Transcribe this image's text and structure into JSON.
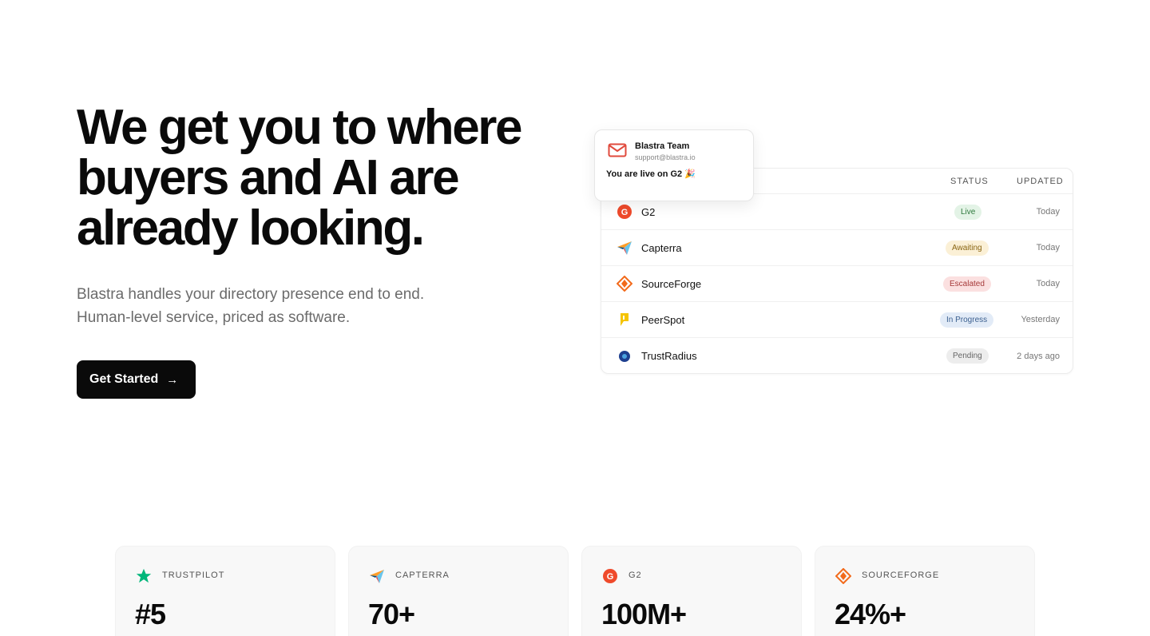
{
  "hero": {
    "title": "We get you to where buyers and AI are already looking.",
    "subtitle_line1": "Blastra handles your directory presence end to end.",
    "subtitle_line2": "Human-level service, priced as software.",
    "cta_label": "Get Started",
    "cta_arrow": "→"
  },
  "notification": {
    "sender": "Blastra Team",
    "email": "support@blastra.io",
    "message": "You are live on G2 🎉",
    "icon": "mail-icon"
  },
  "table": {
    "headers": {
      "status": "STATUS",
      "updated": "UPDATED"
    },
    "rows": [
      {
        "name": "G2",
        "status": "Live",
        "updated": "Today",
        "icon": "g2-logo-icon"
      },
      {
        "name": "Capterra",
        "status": "Awaiting",
        "updated": "Today",
        "icon": "capterra-logo-icon"
      },
      {
        "name": "SourceForge",
        "status": "Escalated",
        "updated": "Today",
        "icon": "sourceforge-logo-icon"
      },
      {
        "name": "PeerSpot",
        "status": "In Progress",
        "updated": "Yesterday",
        "icon": "peerspot-logo-icon"
      },
      {
        "name": "TrustRadius",
        "status": "Pending",
        "updated": "2 days ago",
        "icon": "trustradius-logo-icon"
      }
    ],
    "status_colors": {
      "Live": {
        "bg": "#e3f3e6",
        "fg": "#2f7a3d"
      },
      "Awaiting": {
        "bg": "#fbf0d6",
        "fg": "#8a6512"
      },
      "Escalated": {
        "bg": "#fbe0e0",
        "fg": "#a63a3a"
      },
      "In Progress": {
        "bg": "#e2ebf7",
        "fg": "#3b5f8f"
      },
      "Pending": {
        "bg": "#ededed",
        "fg": "#666666"
      }
    }
  },
  "stats": [
    {
      "label": "TRUSTPILOT",
      "value": "#5",
      "icon": "trustpilot-star-icon"
    },
    {
      "label": "CAPTERRA",
      "value": "70+",
      "icon": "capterra-logo-icon"
    },
    {
      "label": "G2",
      "value": "100M+",
      "icon": "g2-logo-icon"
    },
    {
      "label": "SOURCEFORGE",
      "value": "24%+",
      "icon": "sourceforge-logo-icon"
    }
  ],
  "colors": {
    "g2": "#ef4a2b",
    "trustpilot": "#00b67a",
    "sourceforge": "#f26a1b",
    "peerspot": "#f5c400",
    "trustradius": "#1d3f8f",
    "mail": "#e04a3c"
  }
}
